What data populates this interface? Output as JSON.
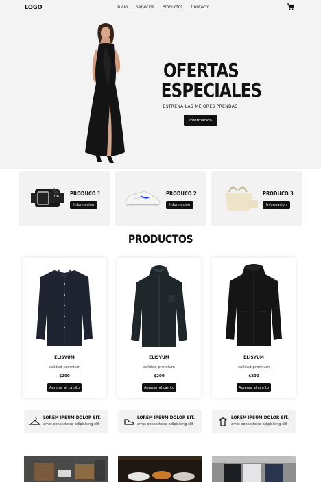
{
  "nav": {
    "logo": "LOGO",
    "links": [
      "Inicio",
      "Servicios",
      "Productos",
      "Contacto"
    ],
    "cart_icon": "cart-icon"
  },
  "hero": {
    "title_line1": "OFERTAS",
    "title_line2": "ESPECIALES",
    "subtitle": "ESTRENA LAS MEJORES PRENDAS",
    "button": "Informacion"
  },
  "features": [
    {
      "title": "PRODUCO 1",
      "button": "Informacion",
      "image": "belt"
    },
    {
      "title": "PRODUCO 2",
      "button": "Informacion",
      "image": "sneaker"
    },
    {
      "title": "PRODUCO 3",
      "button": "Informacion",
      "image": "tote-bag"
    }
  ],
  "products_section": {
    "title": "PRODUCTOS",
    "items": [
      {
        "name": "ELISYUM",
        "desc": "calidad premium",
        "price": "$200",
        "button": "Agregar al carrito",
        "image": "shirt"
      },
      {
        "name": "ELISYUM",
        "desc": "calidad premium",
        "price": "$200",
        "button": "Agregar al carrito",
        "image": "jacket"
      },
      {
        "name": "ELISYUM",
        "desc": "calidad premium",
        "price": "$200",
        "button": "Agregar al carrito",
        "image": "coat"
      }
    ]
  },
  "info": [
    {
      "icon": "hanger-icon",
      "title": "LOREM IPSUM DOLOR SIT.",
      "text": "amet consectetur adipisicing elit"
    },
    {
      "icon": "shoe-icon",
      "title": "LOREM IPSUM DOLOR SIT.",
      "text": "amet consectetur adipisicing elit"
    },
    {
      "icon": "shirt-rack-icon",
      "title": "LOREM IPSUM DOLOR SIT.",
      "text": "amet consectetur adipisicing elit"
    }
  ],
  "colors": {
    "accent": "#111111",
    "panel": "#f2f2f2"
  }
}
